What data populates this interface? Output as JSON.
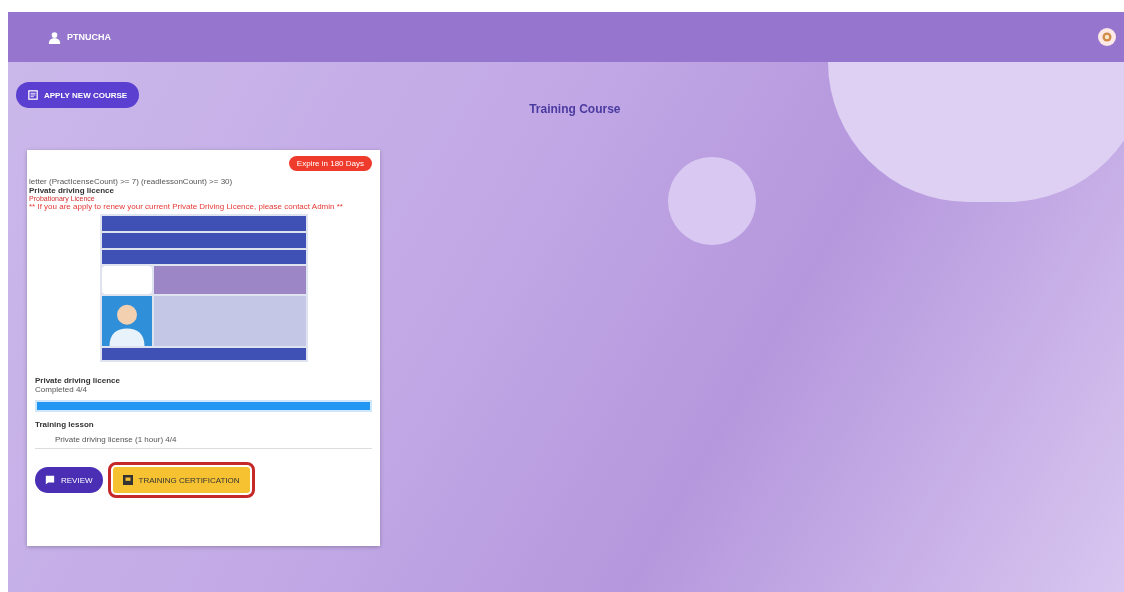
{
  "header": {
    "username": "PTNUCHA"
  },
  "apply_button": {
    "label": "APPLY NEW COURSE"
  },
  "page_title": "Training Course",
  "course_card": {
    "expiry_badge": "Expire in 180 Days",
    "condition_text": "letter (PractIcenseCount) >= 7) (readlessonCount) >= 30)",
    "course_name": "Private driving licence",
    "licence_type": "Probationary Licence",
    "notice": "** If you are apply to renew your current Private Driving Licence, please contact Admin **",
    "progress_title": "Private driving licence",
    "progress_status": "Completed 4/4",
    "progress": {
      "level": 1
    },
    "lesson_heading": "Training lesson",
    "lessons": [
      {
        "label": "Private driving license (1 hour) 4/4"
      }
    ],
    "buttons": [
      {
        "kind": "review",
        "label": "REVIEW",
        "highlighted": false
      },
      {
        "kind": "certificate",
        "label": "TRAINING CERTIFICATION",
        "highlighted": true
      }
    ]
  }
}
